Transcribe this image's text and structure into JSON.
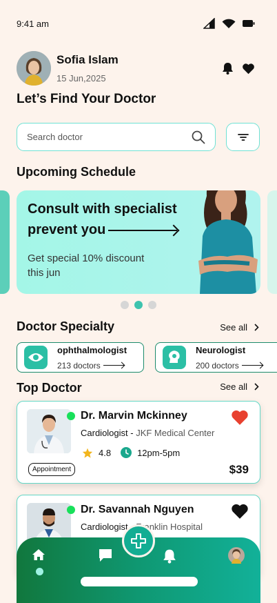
{
  "status_bar": {
    "time": "9:41 am"
  },
  "profile": {
    "name": "Sofia Islam",
    "date": "15 Jun,2025"
  },
  "page_title": "Let’s Find Your Doctor",
  "search": {
    "placeholder": "Search doctor",
    "value": ""
  },
  "schedule": {
    "heading": "Upcoming Schedule",
    "banner_line1": "Consult with specialist",
    "banner_line2": "prevent you",
    "banner_sub": "Get special 10% discount this jun",
    "slides_count": 3,
    "active_slide": 2
  },
  "specialty": {
    "heading": "Doctor Specialty",
    "see_all": "See all",
    "items": [
      {
        "name": "ophthalmologist",
        "count": "213 doctors",
        "icon": "eye-icon"
      },
      {
        "name": "Neurologist",
        "count": "200 doctors",
        "icon": "brain-icon"
      }
    ]
  },
  "top_doctor": {
    "heading": "Top Doctor",
    "see_all": "See all",
    "doctors": [
      {
        "name": "Dr. Marvin Mckinney",
        "specialty": "Cardiologist - ",
        "hospital": "JKF Medical Center",
        "rating": "4.8",
        "hours": "12pm-5pm",
        "badge": "Appointment",
        "price": "$39",
        "favorited": true
      },
      {
        "name": "Dr. Savannah Nguyen",
        "specialty": "Cardiologist - ",
        "hospital": "Franklin Hospital",
        "favorited": false
      }
    ]
  },
  "colors": {
    "background": "#fdf3ec",
    "accent": "#2bbfa5",
    "banner": "#a4f6e7",
    "nav_start": "#11773d",
    "nav_end": "#12b199",
    "favorite": "#e8412f"
  }
}
